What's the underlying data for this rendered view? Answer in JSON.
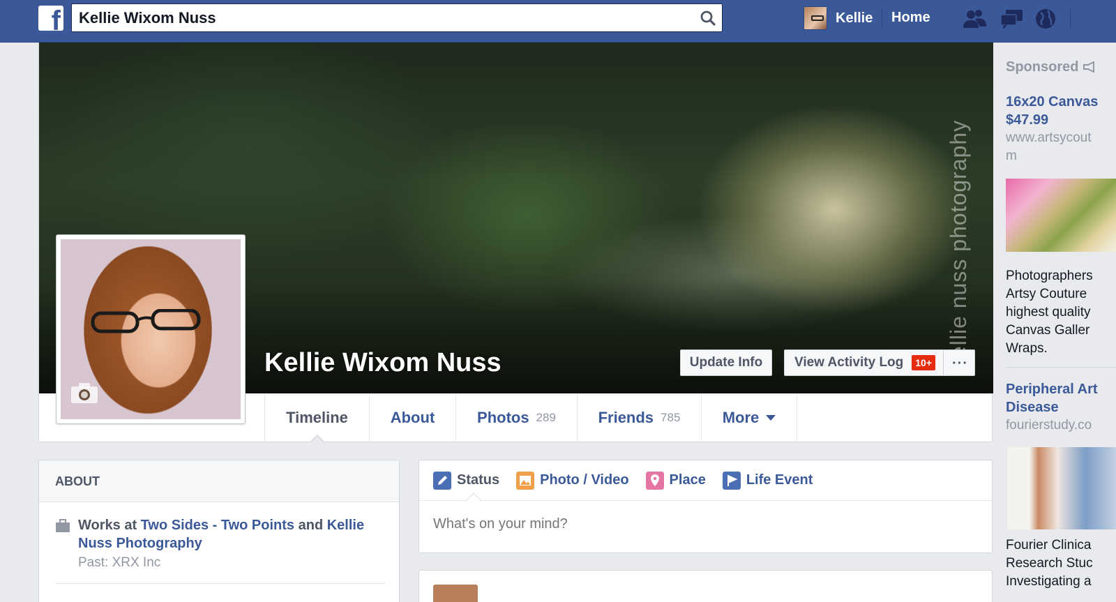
{
  "topbar": {
    "logo_letter": "f",
    "search_value": "Kellie Wixom Nuss",
    "user_name": "Kellie",
    "home_label": "Home",
    "jewels": [
      "friend-requests-icon",
      "messages-icon",
      "notifications-globe-icon"
    ]
  },
  "profile": {
    "name": "Kellie Wixom Nuss",
    "watermark": "kellie nuss photography",
    "update_info_label": "Update Info",
    "activity_log_label": "View Activity Log",
    "activity_badge": "10+",
    "more_dots": "···"
  },
  "tabs": [
    {
      "label": "Timeline",
      "count": ""
    },
    {
      "label": "About",
      "count": ""
    },
    {
      "label": "Photos",
      "count": "289"
    },
    {
      "label": "Friends",
      "count": "785"
    },
    {
      "label": "More",
      "count": ""
    }
  ],
  "about": {
    "heading": "ABOUT",
    "works_prefix": "Works at ",
    "employer1": "Two Sides - Two Points",
    "and_text": " and ",
    "employer2": "Kellie Nuss Photography",
    "past": "Past: XRX Inc"
  },
  "composer": {
    "status_label": "Status",
    "photo_label": "Photo / Video",
    "place_label": "Place",
    "life_event_label": "Life Event",
    "placeholder": "What's on your mind?",
    "colors": {
      "status": "#4a6fb5",
      "photo": "#f0a04b",
      "place": "#e575a3",
      "life_event": "#4a6fb5"
    }
  },
  "ads": {
    "sponsored_label": "Sponsored",
    "ad1_title_line1": "16x20 Canvas",
    "ad1_title_line2": "$47.99",
    "ad1_url_line1": "www.artsycout",
    "ad1_url_line2": "m",
    "ad1_body": [
      "Photographers",
      "Artsy Couture",
      "highest quality",
      "Canvas Galler",
      "Wraps."
    ],
    "ad2_title_line1": "Peripheral Art",
    "ad2_title_line2": "Disease",
    "ad2_url": "fourierstudy.co",
    "ad2_body": [
      "Fourier Clinica",
      "Research Stuc",
      "Investigating a"
    ]
  },
  "colors": {
    "brand": "#3b5998",
    "badge": "#e62d12"
  }
}
